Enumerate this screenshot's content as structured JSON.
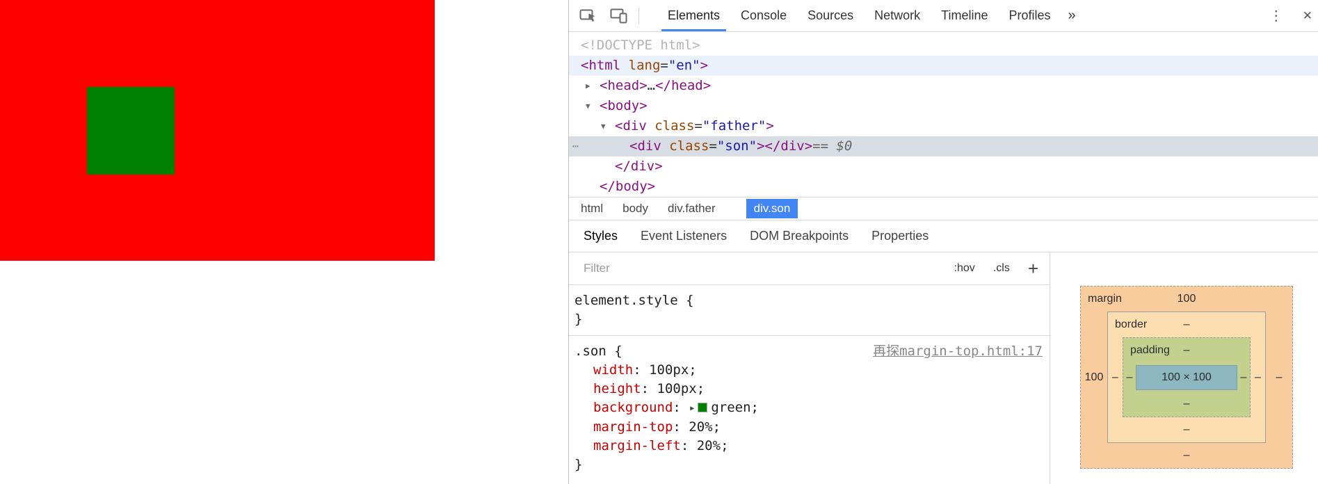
{
  "inspected_page": {
    "father_color": "#ff0000",
    "son_color": "#008000"
  },
  "toolbar": {
    "tabs": {
      "elements": "Elements",
      "console": "Console",
      "sources": "Sources",
      "network": "Network",
      "timeline": "Timeline",
      "profiles": "Profiles"
    },
    "overflow": "»",
    "menu": "⋮",
    "close": "✕"
  },
  "dom_tree": {
    "doctype": "<!DOCTYPE html>",
    "html": {
      "t1": "<html ",
      "attr": "lang",
      "eq": "=",
      "val": "\"en\"",
      "t2": ">"
    },
    "head": {
      "arrow": "▶",
      "t1": "<head>",
      "dots": "…",
      "t2": "</head>"
    },
    "body": {
      "arrow": "▼",
      "t1": "<body>"
    },
    "father": {
      "arrow": "▼",
      "t1": "<div ",
      "attr": "class",
      "eq": "=",
      "val": "\"father\"",
      "t2": ">"
    },
    "son": {
      "gutter": "⋯",
      "t1": "<div ",
      "attr": "class",
      "eq": "=",
      "val": "\"son\"",
      "t2": ">",
      "t3": "</div>",
      "hint": "== $0"
    },
    "close_div": "</div>",
    "close_body": "</body>"
  },
  "breadcrumb": {
    "html": "html",
    "body": "body",
    "father": "div.father",
    "son": "div.son"
  },
  "sidebar_tabs": {
    "styles": "Styles",
    "event_listeners": "Event Listeners",
    "dom_breakpoints": "DOM Breakpoints",
    "properties": "Properties"
  },
  "filter": {
    "placeholder": "Filter",
    "hov": ":hov",
    "cls": ".cls",
    "add": "+"
  },
  "styles": {
    "punct": {
      "colon": ": ",
      "semi": ";",
      "expand": "▶"
    },
    "element_style": {
      "selector": "element.style",
      "brace_open": " {",
      "brace_close": "}"
    },
    "son_rule": {
      "selector": ".son",
      "brace_open": " {",
      "brace_close": "}",
      "source": "再探margin-top.html:17",
      "props": [
        {
          "name": "width",
          "value": "100px"
        },
        {
          "name": "height",
          "value": "100px"
        },
        {
          "name": "background",
          "value": "green",
          "swatch": "#008000"
        },
        {
          "name": "margin-top",
          "value": "20%"
        },
        {
          "name": "margin-left",
          "value": "20%"
        }
      ]
    }
  },
  "box_model": {
    "margin": {
      "label": "margin",
      "top": "100",
      "left": "100",
      "right": "–",
      "bottom": "–"
    },
    "border": {
      "label": "border",
      "top": "–",
      "left": "–",
      "right": "–",
      "bottom": "–"
    },
    "padding": {
      "label": "padding",
      "top": "–",
      "left": "–",
      "right": "–",
      "bottom": "–"
    },
    "content": "100 × 100"
  },
  "colors": {
    "accent": "#4285f4",
    "selection_row": "#d8dde3",
    "hover_row": "#eaf1fb",
    "tag": "#881280",
    "attr_name": "#994500",
    "attr_value": "#1a1aa6",
    "property_name": "#c80000",
    "margin_bg": "#f9cc9d",
    "border_bg": "#fddeb0",
    "padding_bg": "#c4d08e",
    "content_bg": "#8cb6c0"
  }
}
